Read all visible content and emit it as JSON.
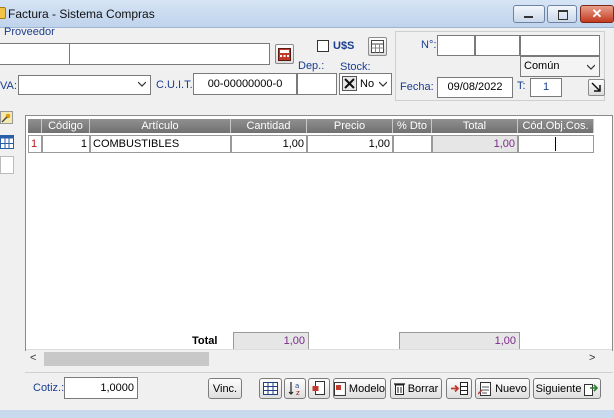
{
  "window": {
    "title": "Factura - Sistema Compras"
  },
  "header": {
    "proveedor_label": "Proveedor",
    "proveedor_code": "",
    "proveedor_name": "",
    "usd_label": "U$S",
    "usd_checked": false,
    "dep_label": "Dep.:",
    "stock_label": "Stock:",
    "stock_value": "No",
    "iva_label": "VA:",
    "iva_value": "",
    "cuit_label": "C.U.I.T.:",
    "cuit_value": "00-00000000-0",
    "dep_value": ""
  },
  "invoice": {
    "numero_label": "N°:",
    "tipo_value": "Común",
    "fecha_label": "Fecha:",
    "fecha_value": "09/08/2022",
    "t_label": "T:",
    "t_value": "1"
  },
  "grid": {
    "columns": [
      "Código",
      "Artículo",
      "Cantidad",
      "Precio",
      "% Dto",
      "Total",
      "Cód.Obj.Cos."
    ],
    "rows": [
      {
        "rownum": "1",
        "codigo": "1",
        "articulo": "COMBUSTIBLES",
        "cantidad": "1,00",
        "precio": "1,00",
        "dto": "",
        "total": "1,00",
        "cod_obj": ""
      }
    ]
  },
  "totals": {
    "label": "Total",
    "cantidad_total": "1,00",
    "total": "1,00"
  },
  "footer": {
    "cotiz_label": "Cotiz.:",
    "cotiz_value": "1,0000",
    "vinc_label": "Vinc.",
    "modelo_label": "Modelo",
    "borrar_label": "Borrar",
    "nuevo_label": "Nuevo",
    "siguiente_label": "Siguiente"
  },
  "colors": {
    "title_bar": "#bfd3ec",
    "grid_header": "#808080",
    "label_blue": "#1a3d8f",
    "total_text": "#7a2a8a"
  }
}
